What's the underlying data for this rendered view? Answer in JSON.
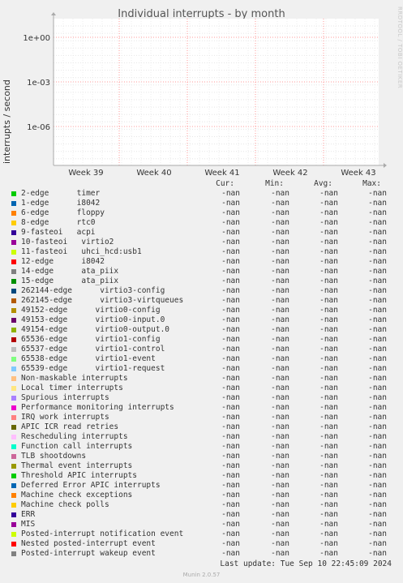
{
  "title": "Individual interrupts - by month",
  "watermark": "RRDTOOL / TOBI OETIKER",
  "chart_data": {
    "type": "line",
    "title": "Individual interrupts - by month",
    "ylabel": "interrupts / second",
    "xlabel": "",
    "y_scale": "log",
    "y_ticks": [
      "1e+00",
      "1e-03",
      "1e-06"
    ],
    "x_ticks": [
      "Week 39",
      "Week 40",
      "Week 41",
      "Week 42",
      "Week 43"
    ],
    "grid": true,
    "series_values": "none (all -nan)"
  },
  "legend": {
    "headers": {
      "cur": "Cur:",
      "min": "Min:",
      "avg": "Avg:",
      "max": "Max:"
    },
    "rows": [
      {
        "label": "2-edge      timer",
        "color": "#00cc00",
        "cur": "-nan",
        "min": "-nan",
        "avg": "-nan",
        "max": "-nan"
      },
      {
        "label": "1-edge      i8042",
        "color": "#0066b3",
        "cur": "-nan",
        "min": "-nan",
        "avg": "-nan",
        "max": "-nan"
      },
      {
        "label": "6-edge      floppy",
        "color": "#ff8000",
        "cur": "-nan",
        "min": "-nan",
        "avg": "-nan",
        "max": "-nan"
      },
      {
        "label": "8-edge      rtc0",
        "color": "#ffcc00",
        "cur": "-nan",
        "min": "-nan",
        "avg": "-nan",
        "max": "-nan"
      },
      {
        "label": "9-fasteoi   acpi",
        "color": "#330099",
        "cur": "-nan",
        "min": "-nan",
        "avg": "-nan",
        "max": "-nan"
      },
      {
        "label": "10-fasteoi   virtio2",
        "color": "#990099",
        "cur": "-nan",
        "min": "-nan",
        "avg": "-nan",
        "max": "-nan"
      },
      {
        "label": "11-fasteoi   uhci_hcd:usb1",
        "color": "#ccff00",
        "cur": "-nan",
        "min": "-nan",
        "avg": "-nan",
        "max": "-nan"
      },
      {
        "label": "12-edge      i8042",
        "color": "#ff0000",
        "cur": "-nan",
        "min": "-nan",
        "avg": "-nan",
        "max": "-nan"
      },
      {
        "label": "14-edge      ata_piix",
        "color": "#808080",
        "cur": "-nan",
        "min": "-nan",
        "avg": "-nan",
        "max": "-nan"
      },
      {
        "label": "15-edge      ata_piix",
        "color": "#008f00",
        "cur": "-nan",
        "min": "-nan",
        "avg": "-nan",
        "max": "-nan"
      },
      {
        "label": "262144-edge      virtio3-config",
        "color": "#00487d",
        "cur": "-nan",
        "min": "-nan",
        "avg": "-nan",
        "max": "-nan"
      },
      {
        "label": "262145-edge      virtio3-virtqueues",
        "color": "#b35a00",
        "cur": "-nan",
        "min": "-nan",
        "avg": "-nan",
        "max": "-nan"
      },
      {
        "label": "49152-edge      virtio0-config",
        "color": "#b38f00",
        "cur": "-nan",
        "min": "-nan",
        "avg": "-nan",
        "max": "-nan"
      },
      {
        "label": "49153-edge      virtio0-input.0",
        "color": "#6b006b",
        "cur": "-nan",
        "min": "-nan",
        "avg": "-nan",
        "max": "-nan"
      },
      {
        "label": "49154-edge      virtio0-output.0",
        "color": "#8fb300",
        "cur": "-nan",
        "min": "-nan",
        "avg": "-nan",
        "max": "-nan"
      },
      {
        "label": "65536-edge      virtio1-config",
        "color": "#b30000",
        "cur": "-nan",
        "min": "-nan",
        "avg": "-nan",
        "max": "-nan"
      },
      {
        "label": "65537-edge      virtio1-control",
        "color": "#bebebe",
        "cur": "-nan",
        "min": "-nan",
        "avg": "-nan",
        "max": "-nan"
      },
      {
        "label": "65538-edge      virtio1-event",
        "color": "#80ff80",
        "cur": "-nan",
        "min": "-nan",
        "avg": "-nan",
        "max": "-nan"
      },
      {
        "label": "65539-edge      virtio1-request",
        "color": "#80c9ff",
        "cur": "-nan",
        "min": "-nan",
        "avg": "-nan",
        "max": "-nan"
      },
      {
        "label": "Non-maskable interrupts",
        "color": "#ffc080",
        "cur": "-nan",
        "min": "-nan",
        "avg": "-nan",
        "max": "-nan"
      },
      {
        "label": "Local timer interrupts",
        "color": "#ffe680",
        "cur": "-nan",
        "min": "-nan",
        "avg": "-nan",
        "max": "-nan"
      },
      {
        "label": "Spurious interrupts",
        "color": "#aa80ff",
        "cur": "-nan",
        "min": "-nan",
        "avg": "-nan",
        "max": "-nan"
      },
      {
        "label": "Performance monitoring interrupts",
        "color": "#ee00cc",
        "cur": "-nan",
        "min": "-nan",
        "avg": "-nan",
        "max": "-nan"
      },
      {
        "label": "IRQ work interrupts",
        "color": "#ff8080",
        "cur": "-nan",
        "min": "-nan",
        "avg": "-nan",
        "max": "-nan"
      },
      {
        "label": "APIC ICR read retries",
        "color": "#666600",
        "cur": "-nan",
        "min": "-nan",
        "avg": "-nan",
        "max": "-nan"
      },
      {
        "label": "Rescheduling interrupts",
        "color": "#ffbfff",
        "cur": "-nan",
        "min": "-nan",
        "avg": "-nan",
        "max": "-nan"
      },
      {
        "label": "Function call interrupts",
        "color": "#00ffcc",
        "cur": "-nan",
        "min": "-nan",
        "avg": "-nan",
        "max": "-nan"
      },
      {
        "label": "TLB shootdowns",
        "color": "#cc6699",
        "cur": "-nan",
        "min": "-nan",
        "avg": "-nan",
        "max": "-nan"
      },
      {
        "label": "Thermal event interrupts",
        "color": "#999900",
        "cur": "-nan",
        "min": "-nan",
        "avg": "-nan",
        "max": "-nan"
      },
      {
        "label": "Threshold APIC interrupts",
        "color": "#00cc00",
        "cur": "-nan",
        "min": "-nan",
        "avg": "-nan",
        "max": "-nan"
      },
      {
        "label": "Deferred Error APIC interrupts",
        "color": "#0066b3",
        "cur": "-nan",
        "min": "-nan",
        "avg": "-nan",
        "max": "-nan"
      },
      {
        "label": "Machine check exceptions",
        "color": "#ff8000",
        "cur": "-nan",
        "min": "-nan",
        "avg": "-nan",
        "max": "-nan"
      },
      {
        "label": "Machine check polls",
        "color": "#ffcc00",
        "cur": "-nan",
        "min": "-nan",
        "avg": "-nan",
        "max": "-nan"
      },
      {
        "label": "ERR",
        "color": "#330099",
        "cur": "-nan",
        "min": "-nan",
        "avg": "-nan",
        "max": "-nan"
      },
      {
        "label": "MIS",
        "color": "#990099",
        "cur": "-nan",
        "min": "-nan",
        "avg": "-nan",
        "max": "-nan"
      },
      {
        "label": "Posted-interrupt notification event",
        "color": "#ccff00",
        "cur": "-nan",
        "min": "-nan",
        "avg": "-nan",
        "max": "-nan"
      },
      {
        "label": "Nested posted-interrupt event",
        "color": "#ff0000",
        "cur": "-nan",
        "min": "-nan",
        "avg": "-nan",
        "max": "-nan"
      },
      {
        "label": "Posted-interrupt wakeup event",
        "color": "#808080",
        "cur": "-nan",
        "min": "-nan",
        "avg": "-nan",
        "max": "-nan"
      }
    ]
  },
  "last_update": "Last update: Tue Sep 10 22:45:09 2024",
  "footer": "Munin 2.0.57",
  "colors": {
    "background": "#f0f0f0",
    "plot_bg": "#ffffff",
    "grid_major": "#ff9999",
    "axis": "#aaaaaa"
  }
}
